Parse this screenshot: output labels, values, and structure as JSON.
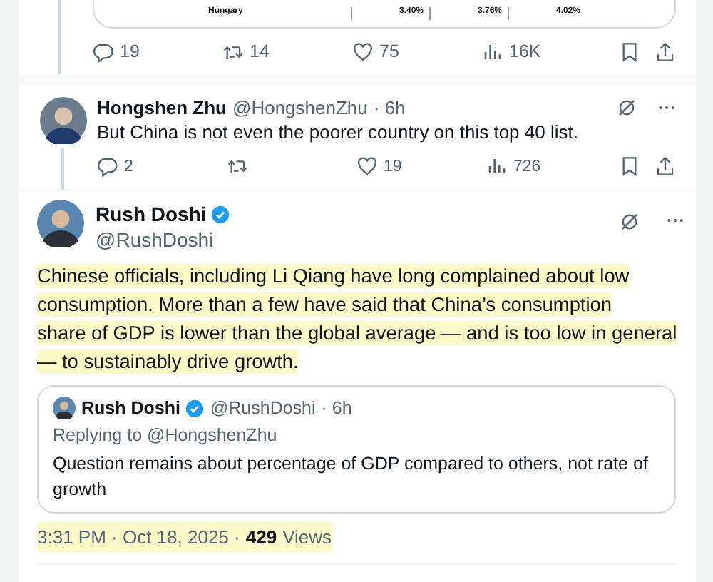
{
  "top_post": {
    "table_rows": [
      {
        "country": "Hungary",
        "column_2": "3.40%",
        "column_3": "3.76%",
        "column_4": "4.02%"
      }
    ],
    "actions": {
      "replies": "19",
      "reposts": "14",
      "likes": "75",
      "views": "16K"
    }
  },
  "reply": {
    "name": "Hongshen Zhu",
    "handle": "@HongshenZhu",
    "time": "· 6h",
    "text": "But China is not even the poorer country on this top 40 list.",
    "actions": {
      "replies": "2",
      "likes": "19",
      "views": "726"
    }
  },
  "main_post": {
    "name": "Rush Doshi",
    "verified": true,
    "handle": "@RushDoshi",
    "highlighted": true,
    "text_lines": [
      "Chinese officials, including Li Qiang have long complained about low",
      "consumption. More than a few have said that China’s consumption",
      "share of GDP is lower than the global average — and is too low in general",
      "— to sustainably drive growth."
    ],
    "quote": {
      "name": "Rush Doshi",
      "verified": true,
      "handle": "@RushDoshi",
      "time": "· 6h",
      "replying_to": "Replying to @HongshenZhu",
      "text": "Question remains about percentage of GDP compared to others, not rate of growth"
    },
    "timestamp": "3:31 PM · Oct 18, 2025 ·",
    "views_count": "429",
    "views_label": "Views"
  }
}
